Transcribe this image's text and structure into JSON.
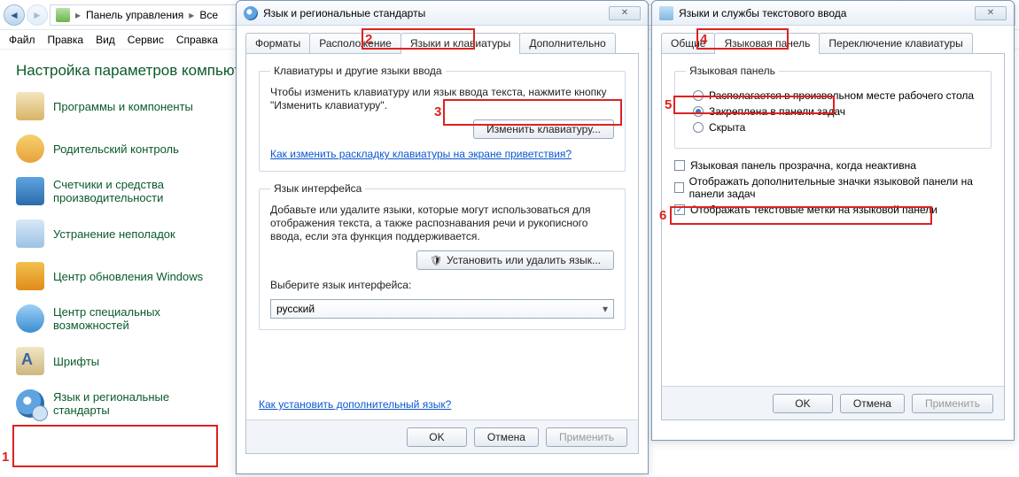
{
  "control_panel": {
    "breadcrumb": {
      "root_icon": "cpl-icon",
      "item1": "Панель управления",
      "item2": "Все"
    },
    "menu": [
      "Файл",
      "Правка",
      "Вид",
      "Сервис",
      "Справка"
    ],
    "heading": "Настройка параметров компьюте",
    "items": [
      {
        "icon": "programs-icon",
        "label": "Программы и компоненты"
      },
      {
        "icon": "parental-icon",
        "label": "Родительский контроль"
      },
      {
        "icon": "counters-icon",
        "label": "Счетчики и средства производительности"
      },
      {
        "icon": "trouble-icon",
        "label": "Устранение неполадок"
      },
      {
        "icon": "winupd-icon",
        "label": "Центр обновления Windows"
      },
      {
        "icon": "access-icon",
        "label": "Центр специальных возможностей"
      },
      {
        "icon": "fonts-icon",
        "label": "Шрифты"
      },
      {
        "icon": "region-icon",
        "label": "Язык и региональные стандарты"
      }
    ]
  },
  "dialog1": {
    "title": "Язык и региональные стандарты",
    "tabs": [
      "Форматы",
      "Расположение",
      "Языки и клавиатуры",
      "Дополнительно"
    ],
    "group1_legend": "Клавиатуры и другие языки ввода",
    "group1_desc": "Чтобы изменить клавиатуру или язык ввода текста, нажмите кнопку \"Изменить клавиатуру\".",
    "change_kbd_btn": "Изменить клавиатуру...",
    "link1": "Как изменить раскладку клавиатуры на экране приветствия?",
    "group2_legend": "Язык интерфейса",
    "group2_desc": "Добавьте или удалите языки, которые могут использоваться для отображения текста, а также распознавания речи и рукописного ввода, если эта функция поддерживается.",
    "install_btn": "Установить или удалить язык...",
    "select_label": "Выберите язык интерфейса:",
    "select_value": "русский",
    "link2": "Как установить дополнительный язык?",
    "ok": "OK",
    "cancel": "Отмена",
    "apply": "Применить"
  },
  "dialog2": {
    "title": "Языки и службы текстового ввода",
    "tabs": [
      "Общие",
      "Языковая панель",
      "Переключение клавиатуры"
    ],
    "group_legend": "Языковая панель",
    "radio1": "Располагается в произвольном месте рабочего стола",
    "radio2": "Закреплена в панели задач",
    "radio3": "Скрыта",
    "chk1": "Языковая панель прозрачна, когда неактивна",
    "chk2": "Отображать дополнительные значки языковой панели на панели задач",
    "chk3": "Отображать текстовые метки на языковой панели",
    "ok": "OK",
    "cancel": "Отмена",
    "apply": "Применить"
  },
  "callouts": {
    "n1": "1",
    "n2": "2",
    "n3": "3",
    "n4": "4",
    "n5": "5",
    "n6": "6"
  }
}
